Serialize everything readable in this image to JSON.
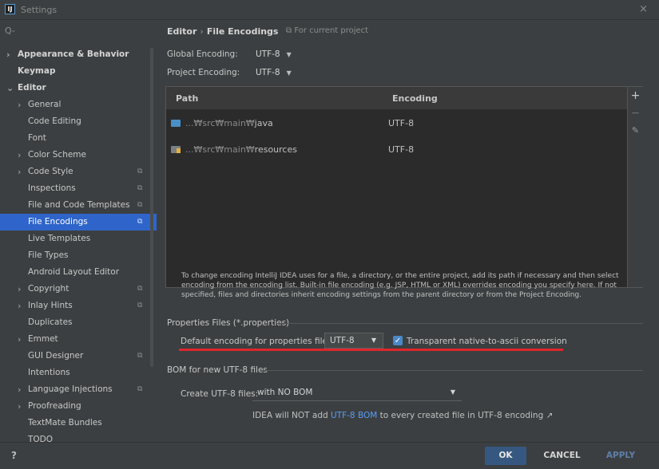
{
  "window": {
    "title": "Settings",
    "logo_text": "IJ",
    "close_glyph": "×"
  },
  "search": {
    "placeholder": "Q-"
  },
  "sidebar": {
    "items": [
      {
        "label": "Appearance & Behavior",
        "arrow": "›"
      },
      {
        "label": "Keymap"
      },
      {
        "label": "Editor",
        "arrow": "⌄"
      },
      {
        "label": "General",
        "arrow": "›"
      },
      {
        "label": "Code Editing"
      },
      {
        "label": "Font"
      },
      {
        "label": "Color Scheme",
        "arrow": "›"
      },
      {
        "label": "Code Style",
        "arrow": "›"
      },
      {
        "label": "Inspections"
      },
      {
        "label": "File and Code Templates"
      },
      {
        "label": "File Encodings"
      },
      {
        "label": "Live Templates"
      },
      {
        "label": "File Types"
      },
      {
        "label": "Android Layout Editor"
      },
      {
        "label": "Copyright",
        "arrow": "›"
      },
      {
        "label": "Inlay Hints",
        "arrow": "›"
      },
      {
        "label": "Duplicates"
      },
      {
        "label": "Emmet",
        "arrow": "›"
      },
      {
        "label": "GUI Designer"
      },
      {
        "label": "Intentions"
      },
      {
        "label": "Language Injections",
        "arrow": "›"
      },
      {
        "label": "Proofreading",
        "arrow": "›"
      },
      {
        "label": "TextMate Bundles"
      },
      {
        "label": "TODO"
      }
    ],
    "project_icon": "⧉"
  },
  "breadcrumb": {
    "parent": "Editor",
    "separator": "›",
    "current": "File Encodings",
    "scope": "⧉ For current project"
  },
  "global_encoding": {
    "label": "Global Encoding:",
    "value": "UTF-8"
  },
  "project_encoding": {
    "label": "Project Encoding:",
    "value": "UTF-8"
  },
  "table": {
    "col_path": "Path",
    "col_encoding": "Encoding",
    "rows": [
      {
        "path_prefix": "...₩src₩main₩",
        "path_name": "java",
        "encoding": "UTF-8"
      },
      {
        "path_prefix": "...₩src₩main₩",
        "path_name": "resources",
        "encoding": "UTF-8"
      }
    ],
    "tools": {
      "add": "+",
      "remove": "−",
      "edit": "✎"
    }
  },
  "description": "To change encoding IntelliJ IDEA uses for a file, a directory, or the entire project, add its path if necessary and then select encoding from the encoding list. Built-in file encoding (e.g. JSP, HTML or XML) overrides encoding you specify here. If not specified, files and directories inherit encoding settings from the parent directory or from the Project Encoding.",
  "properties": {
    "section": "Properties Files (*.properties)",
    "default_label": "Default encoding for properties files:",
    "default_value": "UTF-8",
    "transparent_label": "Transparent native-to-ascii conversion",
    "transparent_checked": true
  },
  "bom": {
    "section": "BOM for new UTF-8 files",
    "create_label": "Create UTF-8 files:",
    "create_value": "with NO BOM",
    "note_pre": "IDEA will NOT add ",
    "note_link": "UTF-8 BOM",
    "note_post": " to every created file in UTF-8 encoding ↗"
  },
  "footer": {
    "help": "?",
    "ok": "OK",
    "cancel": "CANCEL",
    "apply": "APPLY"
  },
  "colors": {
    "accent": "#2f65ca",
    "highlight_line": "#e0262b",
    "link": "#589df6"
  }
}
